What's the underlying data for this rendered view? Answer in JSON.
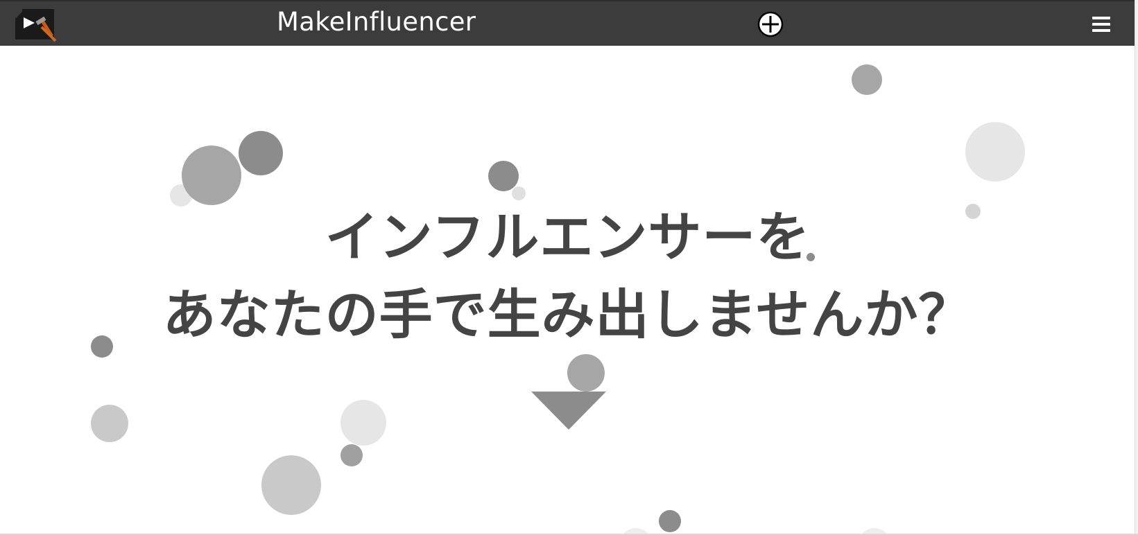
{
  "header": {
    "brand_name": "MakeInfluencer",
    "logo_icon": "influencer-logo-icon",
    "add_icon": "plus-circle-icon",
    "menu_icon": "hamburger-menu-icon",
    "colors": {
      "bar": "#3c3c3c",
      "text": "#ffffff"
    }
  },
  "hero": {
    "line1": "インフルエンサーを",
    "line2": "あなたの手で生み出しませんか？",
    "text_color": "#444444",
    "scroll_icon": "down-triangle-icon"
  },
  "decoration": {
    "icon": "circle-bubble-icon",
    "palette": [
      "#8c8c8c",
      "#a6a6a6",
      "#c9c9c9",
      "#e6e6e6"
    ]
  }
}
